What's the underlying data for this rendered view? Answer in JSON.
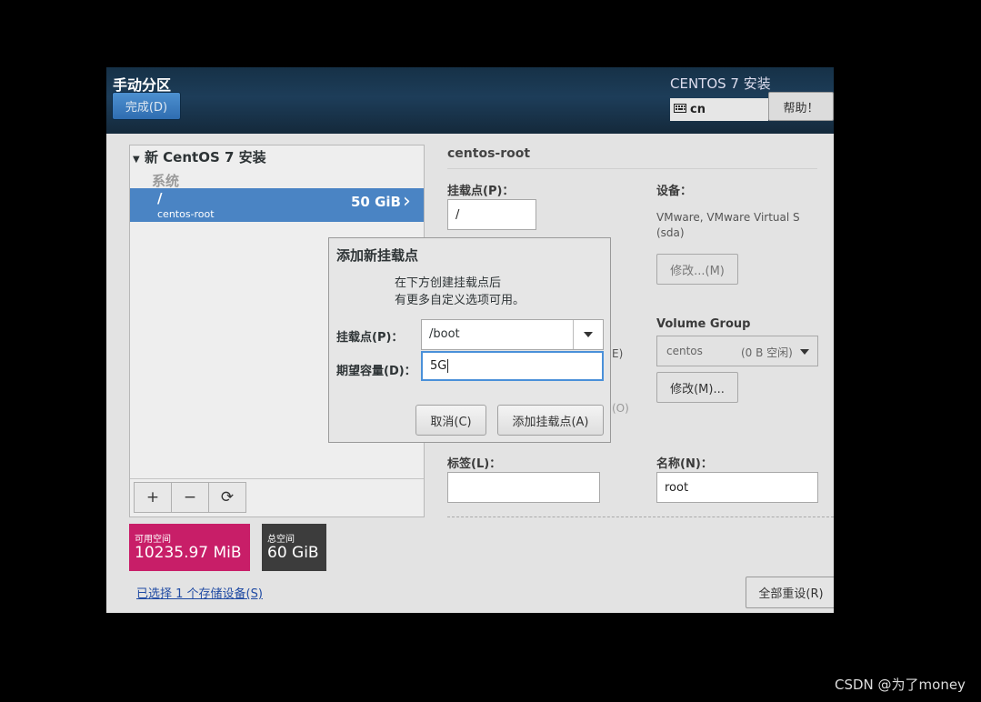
{
  "header": {
    "title": "手动分区",
    "done_label": "完成(D)",
    "product": "CENTOS 7 安装",
    "keyboard_layout": "cn",
    "help_label": "帮助！"
  },
  "left_panel": {
    "install_title": "新 CentOS 7 安装",
    "system_label": "系统",
    "selected_row": {
      "mount": "/",
      "name": "centos-root",
      "size": "50 GiB"
    },
    "tool_add": "+",
    "tool_remove": "−",
    "tool_refresh": "⟳"
  },
  "space": {
    "available_label": "可用空间",
    "available_value": "10235.97 MiB",
    "total_label": "总空间",
    "total_value": "60 GiB"
  },
  "device_link": "已选择 1 个存储设备(S)",
  "right_panel": {
    "title": "centos-root",
    "mount_label": "挂载点(P)：",
    "mount_value": "/",
    "device_label": "设备：",
    "device_value_1": "VMware, VMware Virtual S",
    "device_value_2": "(sda)",
    "modify_label": "修改...(M)",
    "volume_group_label": "Volume Group",
    "vg_name": "centos",
    "vg_free": "(0 B 空闲)",
    "vg_modify_label": "修改(M)...",
    "partial_e": "E)",
    "partial_o": "(O)",
    "tag_label": "标签(L)：",
    "tag_value": "",
    "name_label": "名称(N)：",
    "name_value": "root",
    "reset_label": "全部重设(R)"
  },
  "dialog": {
    "title": "添加新挂载点",
    "desc_line1": "在下方创建挂载点后",
    "desc_line2": "有更多自定义选项可用。",
    "mount_label": "挂载点(P)：",
    "mount_value": "/boot",
    "capacity_label": "期望容量(D)：",
    "capacity_value": "5G",
    "cancel_label": "取消(C)",
    "add_label": "添加挂载点(A)"
  },
  "watermark": "CSDN @为了money"
}
